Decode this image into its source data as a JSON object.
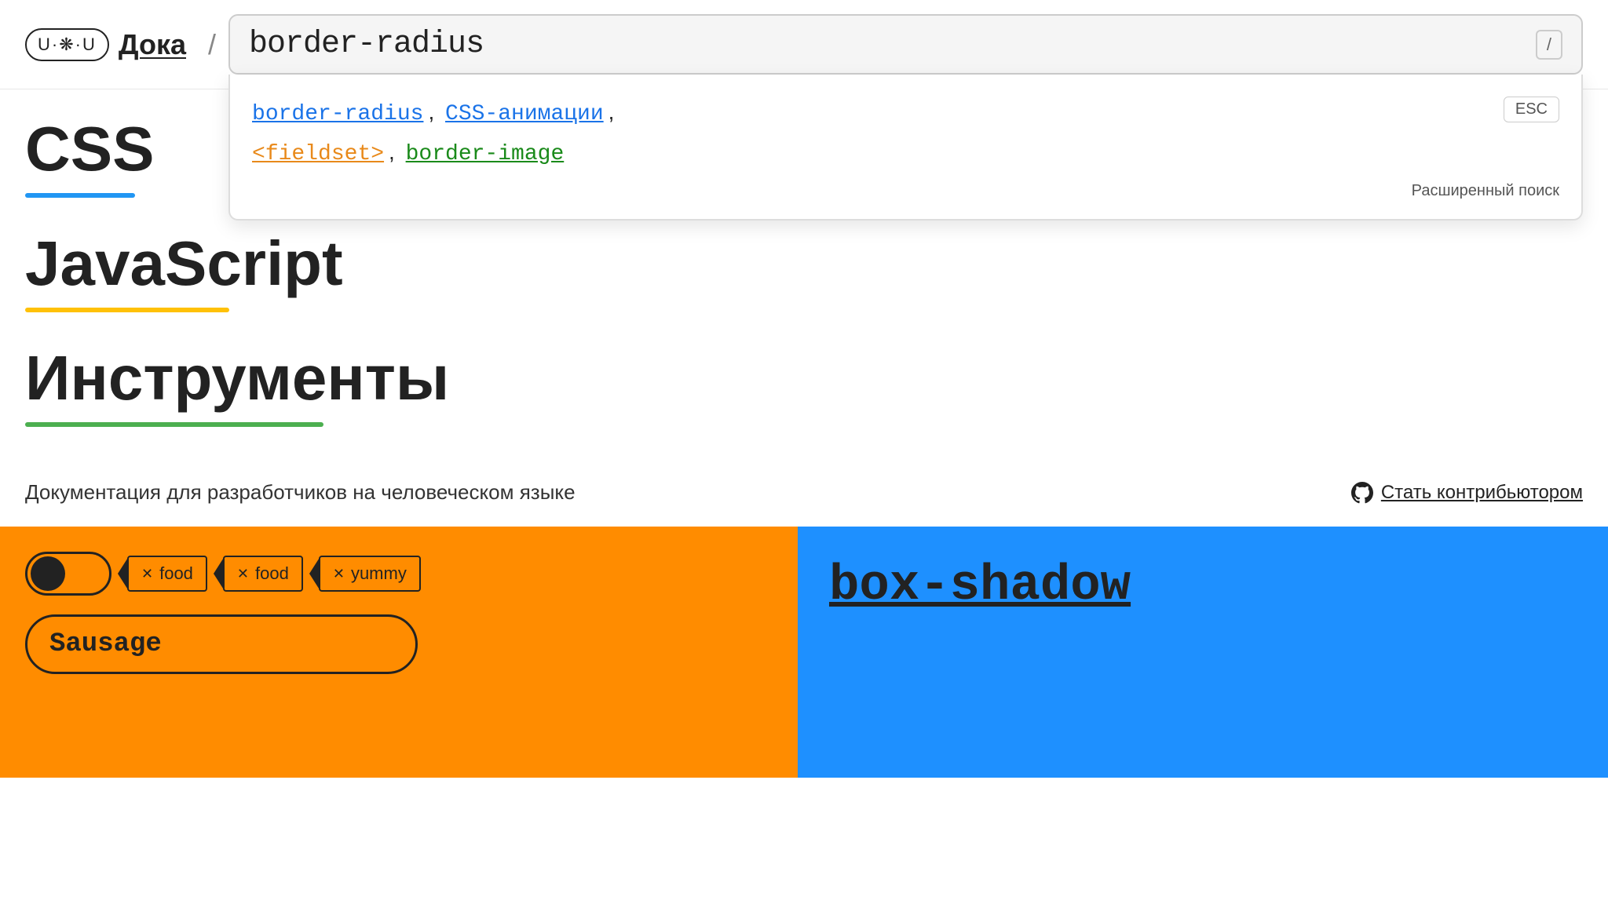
{
  "header": {
    "logo_text": "U·❋·U",
    "site_name": "Дока",
    "separator": "/",
    "search_query": "border-radius",
    "search_slash_label": "/",
    "esc_label": "ESC"
  },
  "dropdown": {
    "results": [
      {
        "id": "border-radius",
        "label": "border-radius",
        "color": "blue"
      },
      {
        "id": "css-animations",
        "label": "CSS-анимации",
        "color": "blue"
      },
      {
        "id": "fieldset",
        "label": "<fieldset>",
        "color": "orange"
      },
      {
        "id": "border-image",
        "label": "border-image",
        "color": "green"
      }
    ],
    "advanced_search_label": "Расширенный поиск"
  },
  "nav_sections": [
    {
      "id": "css",
      "label": "CSS",
      "underline_color": "#2196F3",
      "underline_width": 140
    },
    {
      "id": "javascript",
      "label": "JavaScript",
      "underline_color": "#FFC107",
      "underline_width": 260
    },
    {
      "id": "tools",
      "label": "Инструменты",
      "underline_color": "#4CAF50",
      "underline_width": 380
    }
  ],
  "footer": {
    "tagline": "Документация для разработчиков на человеческом языке",
    "contribute_label": "Стать контрибьютором"
  },
  "cards": [
    {
      "id": "card-orange",
      "bg_color": "#FF8C00",
      "toggle_active": true,
      "tags": [
        "food",
        "food",
        "yummy"
      ],
      "input_placeholder": "Sausage"
    },
    {
      "id": "card-blue",
      "bg_color": "#1E90FF",
      "title": "box-shadow"
    }
  ]
}
